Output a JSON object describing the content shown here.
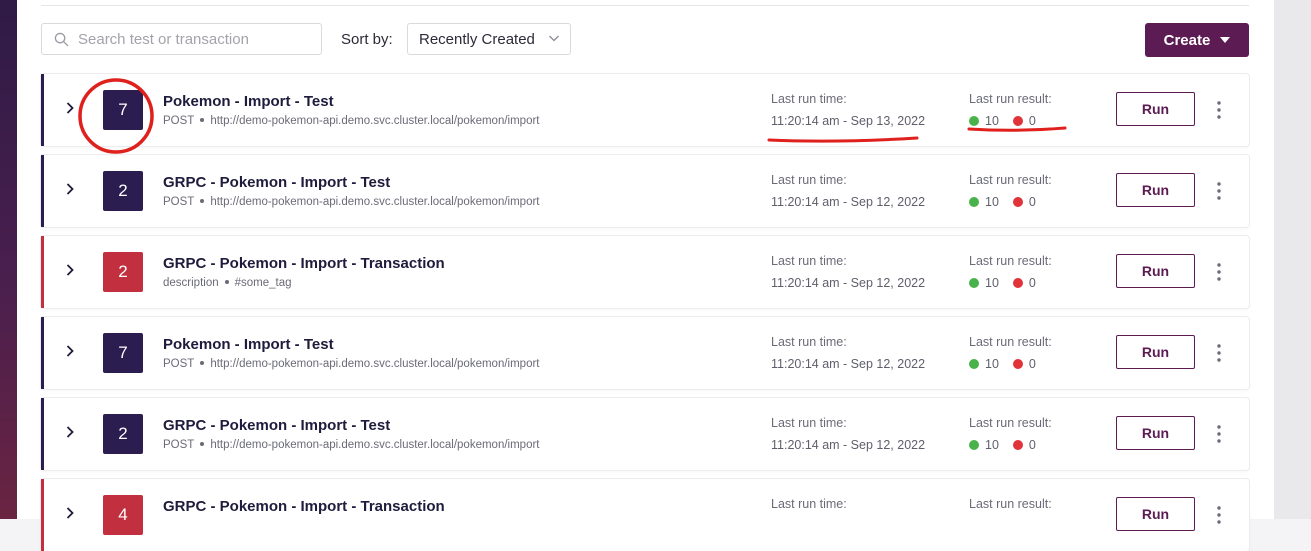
{
  "toolbar": {
    "search_placeholder": "Search test or transaction",
    "sort_label": "Sort by:",
    "sort_value": "Recently Created",
    "create_label": "Create"
  },
  "labels": {
    "run_time": "Last run time:",
    "run_result": "Last run result:",
    "run_button": "Run"
  },
  "colors": {
    "brand": "#5c1b52",
    "test_accent": "#2b1d4f",
    "transaction_accent": "#c2303f",
    "pass": "#49b24a",
    "fail": "#e0343a",
    "annotation": "#e0201c"
  },
  "items": [
    {
      "kind": "test",
      "badge": "7",
      "title": "Pokemon - Import - Test",
      "meta_a": "POST",
      "meta_b": "http://demo-pokemon-api.demo.svc.cluster.local/pokemon/import",
      "run_time": "11:20:14 am  -  Sep 13, 2022",
      "passed": "10",
      "failed": "0"
    },
    {
      "kind": "test",
      "badge": "2",
      "title": "GRPC - Pokemon - Import - Test",
      "meta_a": "POST",
      "meta_b": "http://demo-pokemon-api.demo.svc.cluster.local/pokemon/import",
      "run_time": "11:20:14 am  -  Sep 12, 2022",
      "passed": "10",
      "failed": "0"
    },
    {
      "kind": "transaction",
      "badge": "2",
      "title": "GRPC - Pokemon - Import - Transaction",
      "meta_a": "description",
      "meta_b": "#some_tag",
      "run_time": "11:20:14 am  -  Sep 12, 2022",
      "passed": "10",
      "failed": "0"
    },
    {
      "kind": "test",
      "badge": "7",
      "title": "Pokemon - Import - Test",
      "meta_a": "POST",
      "meta_b": "http://demo-pokemon-api.demo.svc.cluster.local/pokemon/import",
      "run_time": "11:20:14 am  -  Sep 12, 2022",
      "passed": "10",
      "failed": "0"
    },
    {
      "kind": "test",
      "badge": "2",
      "title": "GRPC - Pokemon - Import - Test",
      "meta_a": "POST",
      "meta_b": "http://demo-pokemon-api.demo.svc.cluster.local/pokemon/import",
      "run_time": "11:20:14 am  -  Sep 12, 2022",
      "passed": "10",
      "failed": "0"
    },
    {
      "kind": "transaction",
      "badge": "4",
      "title": "GRPC - Pokemon - Import - Transaction",
      "meta_a": "",
      "meta_b": "",
      "run_time": "",
      "passed": "",
      "failed": ""
    }
  ]
}
